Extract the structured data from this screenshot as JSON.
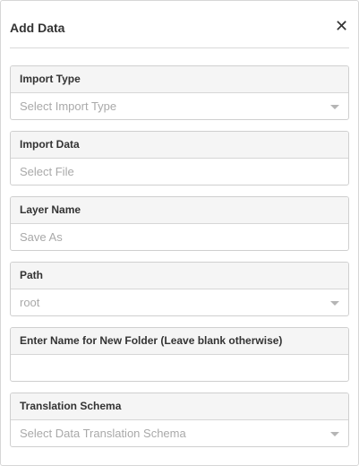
{
  "dialog": {
    "title": "Add Data",
    "close_glyph": "✕",
    "close_icon": "close-icon"
  },
  "fields": {
    "import_type": {
      "label": "Import Type",
      "placeholder": "Select Import Type",
      "icon": "chevron-down-icon"
    },
    "import_data": {
      "label": "Import Data",
      "placeholder": "Select File"
    },
    "layer_name": {
      "label": "Layer Name",
      "placeholder": "Save As"
    },
    "path": {
      "label": "Path",
      "value": "root",
      "icon": "chevron-down-icon"
    },
    "new_folder": {
      "label": "Enter Name for New Folder (Leave blank otherwise)",
      "value": ""
    },
    "translation_schema": {
      "label": "Translation Schema",
      "placeholder": "Select Data Translation Schema",
      "icon": "chevron-down-icon"
    }
  }
}
